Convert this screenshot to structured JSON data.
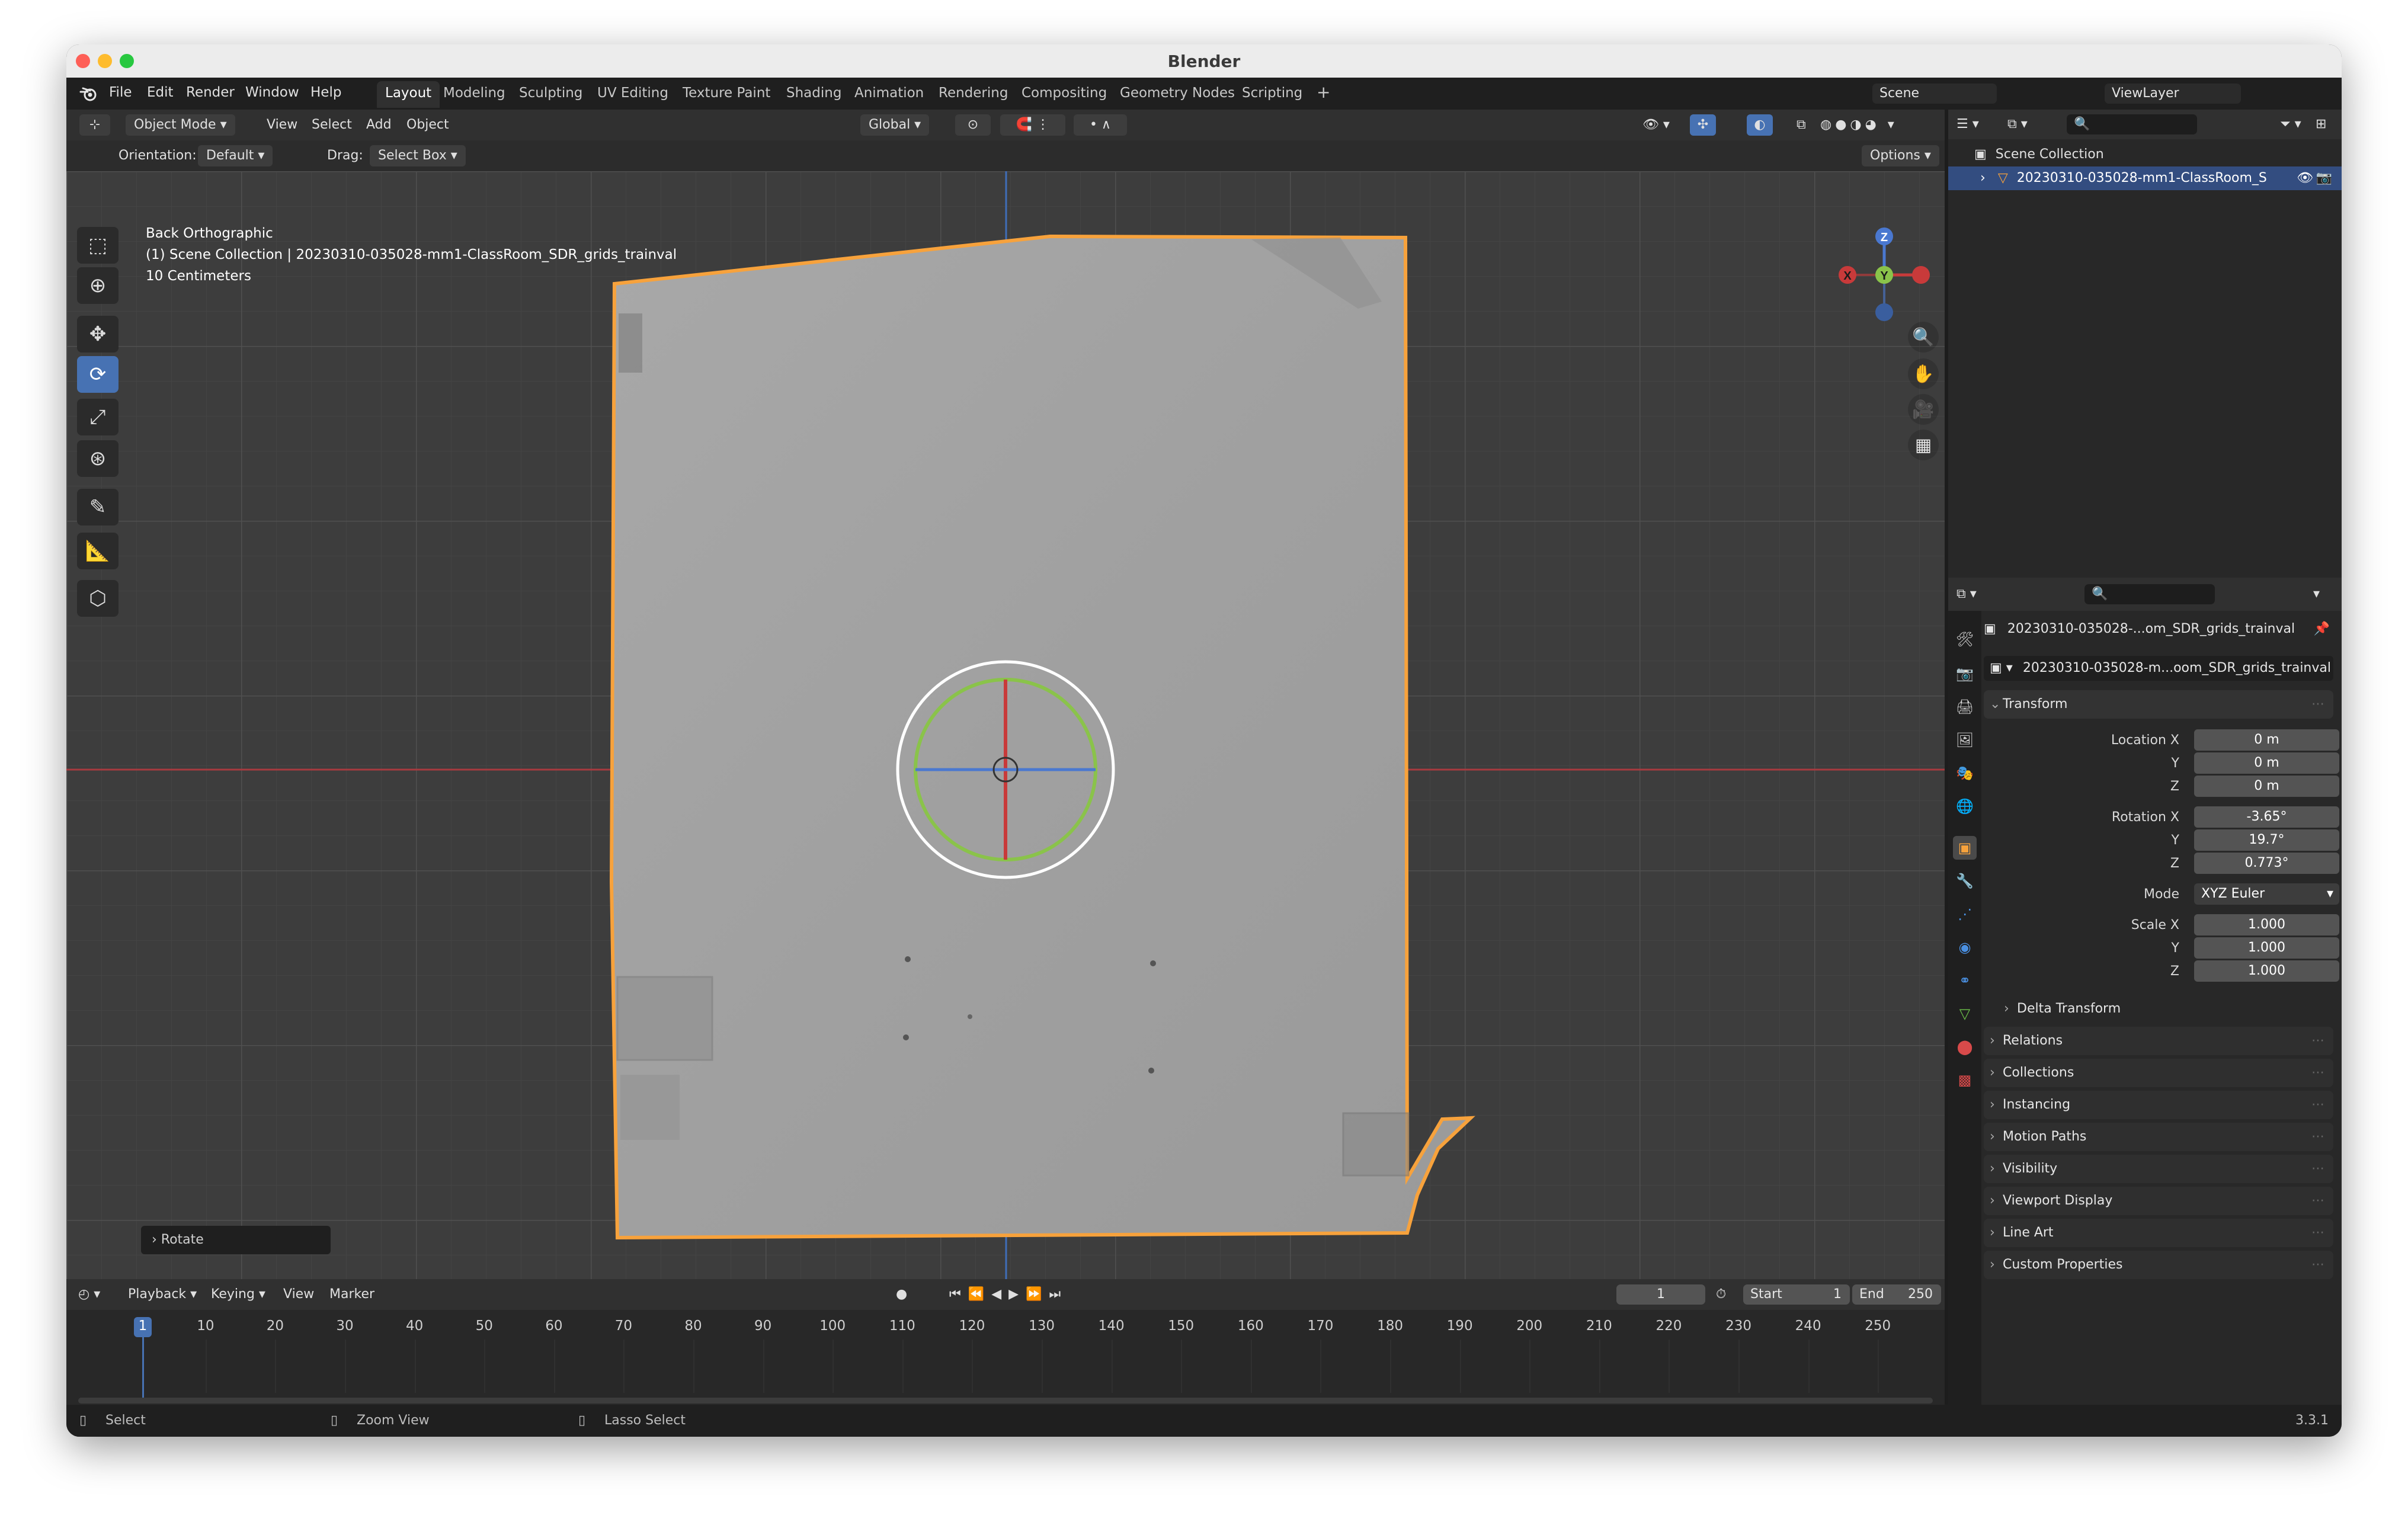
{
  "window": {
    "title": "Blender"
  },
  "menu": [
    "File",
    "Edit",
    "Render",
    "Window",
    "Help"
  ],
  "workspaces": [
    "Layout",
    "Modeling",
    "Sculpting",
    "UV Editing",
    "Texture Paint",
    "Shading",
    "Animation",
    "Rendering",
    "Compositing",
    "Geometry Nodes",
    "Scripting"
  ],
  "workspace_add": "+",
  "scene": {
    "name": "Scene",
    "view_layer": "ViewLayer"
  },
  "viewport_header": {
    "mode": "Object Mode",
    "menus": [
      "View",
      "Select",
      "Add",
      "Object"
    ],
    "transform_orientation": "Global",
    "orientation_label": "Orientation:",
    "orientation_value": "Default",
    "drag_label": "Drag:",
    "drag_value": "Select Box",
    "options_label": "Options"
  },
  "viewport": {
    "view_name": "Back Orthographic",
    "collection_info": "(1) Scene Collection | 20230310-035028-mm1-ClassRoom_SDR_grids_trainval",
    "scale_info": "10 Centimeters",
    "last_operator": "Rotate",
    "gizmo_axes": {
      "z": "Z",
      "y": "Y",
      "x": "X"
    }
  },
  "timeline": {
    "menus": [
      "Playback",
      "Keying",
      "View",
      "Marker"
    ],
    "current_frame": "1",
    "start_label": "Start",
    "start_value": "1",
    "end_label": "End",
    "end_value": "250",
    "frame_ticks": [
      "1",
      "10",
      "20",
      "30",
      "40",
      "50",
      "60",
      "70",
      "80",
      "90",
      "100",
      "110",
      "120",
      "130",
      "140",
      "150",
      "160",
      "170",
      "180",
      "190",
      "200",
      "210",
      "220",
      "230",
      "240",
      "250"
    ]
  },
  "statusbar": {
    "select": "Select",
    "zoom": "Zoom View",
    "lasso": "Lasso Select",
    "version": "3.3.1"
  },
  "outliner": {
    "root": "Scene Collection",
    "object": "20230310-035028-mm1-ClassRoom_S"
  },
  "properties": {
    "object_name": "20230310-035028-...om_SDR_grids_trainval",
    "object_datablock": "20230310-035028-m...oom_SDR_grids_trainval",
    "transform_title": "Transform",
    "location_label": "Location X",
    "location": [
      "0 m",
      "0 m",
      "0 m"
    ],
    "rotation_label": "Rotation X",
    "rotation": [
      "-3.65°",
      "19.7°",
      "0.773°"
    ],
    "mode_label": "Mode",
    "mode_value": "XYZ Euler",
    "scale_label": "Scale X",
    "scale": [
      "1.000",
      "1.000",
      "1.000"
    ],
    "axis_y": "Y",
    "axis_z": "Z",
    "delta_transform": "Delta Transform",
    "sections": [
      "Relations",
      "Collections",
      "Instancing",
      "Motion Paths",
      "Visibility",
      "Viewport Display",
      "Line Art",
      "Custom Properties"
    ]
  },
  "colors": {
    "accent_blue": "#4772b3",
    "selection_orange": "#f7a23c",
    "axis_red": "#c83a3a",
    "axis_green": "#8ac34a",
    "axis_blue": "#4a78d0"
  }
}
